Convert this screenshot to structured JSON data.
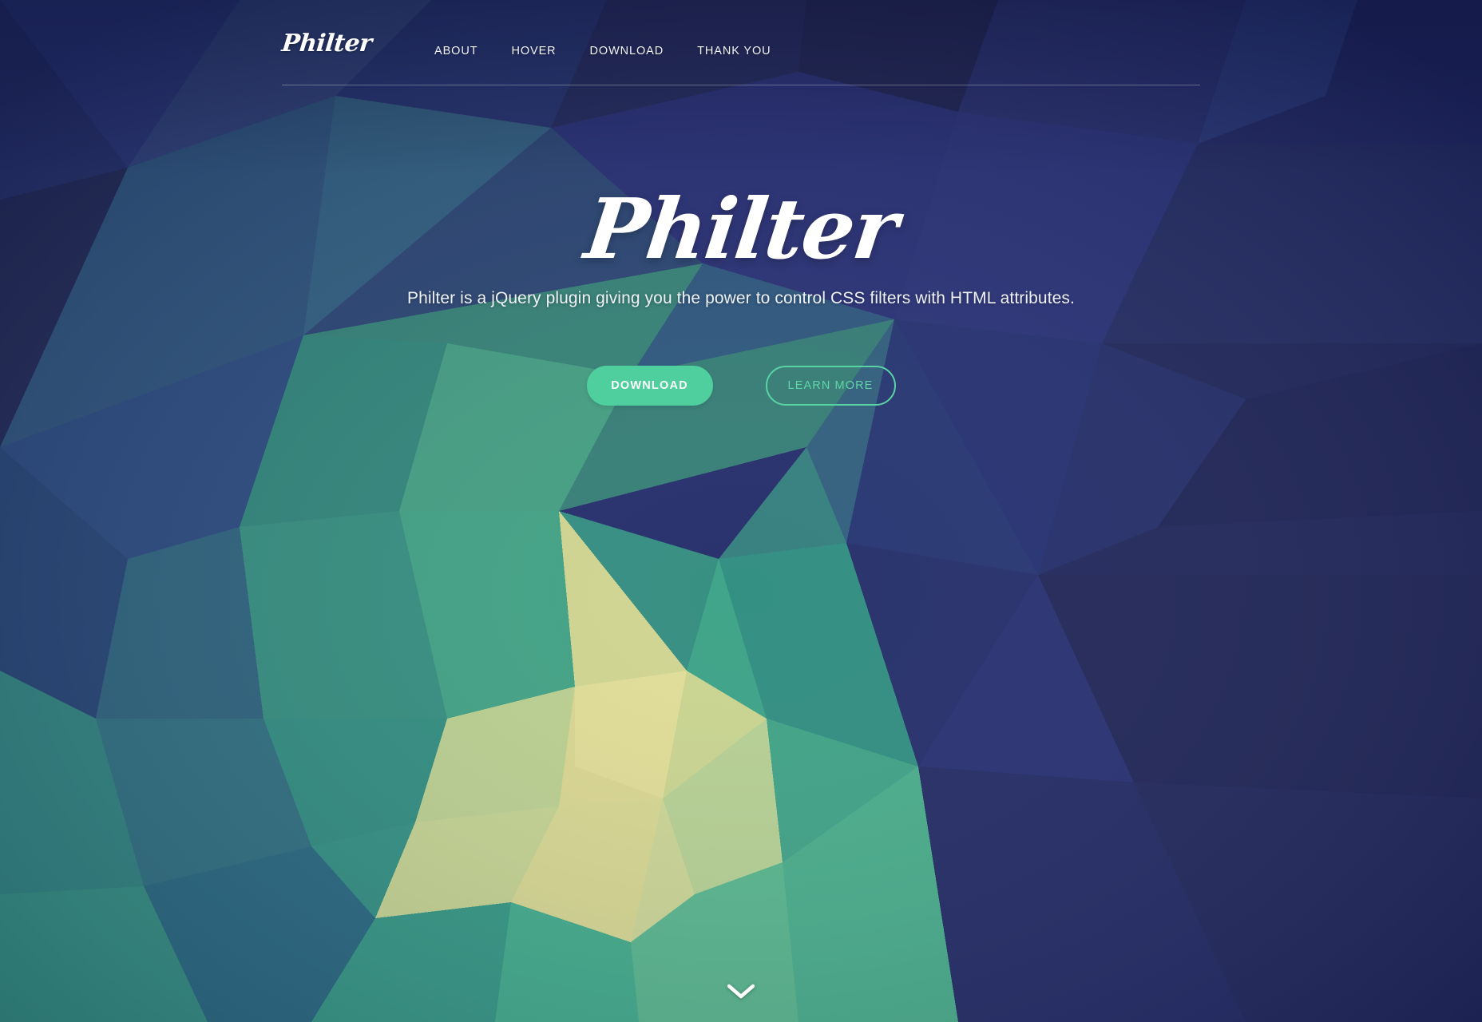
{
  "site": {
    "brand": "Philter",
    "nav": [
      {
        "label": "ABOUT"
      },
      {
        "label": "HOVER"
      },
      {
        "label": "DOWNLOAD"
      },
      {
        "label": "THANK YOU"
      }
    ]
  },
  "hero": {
    "title": "Philter",
    "tagline": "Philter is a jQuery plugin giving you the power to control CSS filters with HTML attributes.",
    "primary_button": "DOWNLOAD",
    "secondary_button": "LEARN MORE"
  },
  "scroll_indicator": {
    "icon": "chevron-down-icon"
  },
  "colors": {
    "accent_green": "#4ecf9d",
    "ghost_border": "#58d3a4",
    "ghost_text": "#5fd6a8",
    "text_white": "#ffffff",
    "bg_navy_dark": "#171f4e",
    "bg_navy": "#222a6b",
    "bg_blue": "#2a3a7a",
    "bg_teal": "#2b7e7e",
    "bg_green": "#3aa87a",
    "bg_green_light": "#78c78c",
    "bg_yellow": "#ddd98c",
    "rule": "rgba(255,255,255,0.30)"
  }
}
